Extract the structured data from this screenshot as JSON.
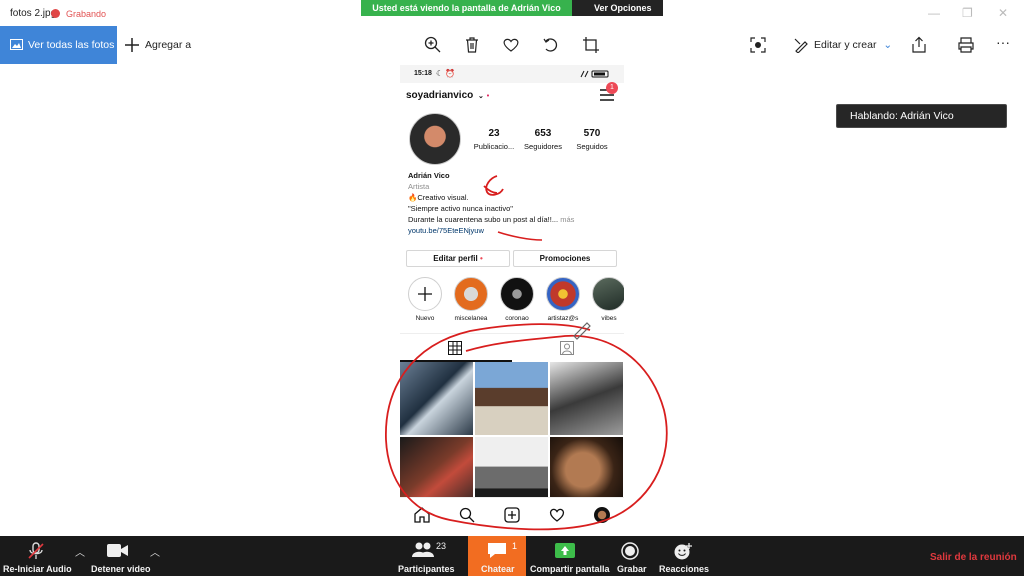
{
  "window": {
    "title": "fotos 2.jpg",
    "recording_label": "Grabando",
    "banner_text": "Usted está viendo la pantalla de Adrián Vico",
    "view_options": "Ver Opciones"
  },
  "toolbar": {
    "see_all": "Ver todas las fotos",
    "add_to": "Agregar a",
    "edit_create": "Editar y crear",
    "icons": [
      "zoom-in-icon",
      "delete-icon",
      "favorite-icon",
      "rotate-icon",
      "crop-icon",
      "enhance-icon",
      "share-icon",
      "print-icon",
      "more-icon"
    ]
  },
  "speaking_label": "Hablando: Adrián Vico",
  "phone": {
    "time": "15:18",
    "username": "soyadrianvico",
    "notification_count": "1",
    "stats": [
      {
        "value": "23",
        "label": "Publicacio..."
      },
      {
        "value": "653",
        "label": "Seguidores"
      },
      {
        "value": "570",
        "label": "Seguidos"
      }
    ],
    "bio": {
      "name": "Adrián Vico",
      "category": "Artista",
      "line1": "🔥Creativo visual.",
      "line2": "\"Siempre activo nunca inactivo\"",
      "line3": "Durante la cuarentena subo un post al día!!...",
      "more": "más",
      "link": "youtu.be/75EteENjyuw"
    },
    "buttons": {
      "edit_profile": "Editar perfil",
      "promotions": "Promociones"
    },
    "highlights": [
      {
        "label": "Nuevo"
      },
      {
        "label": "miscelanea"
      },
      {
        "label": "coronao"
      },
      {
        "label": "artistaz@s"
      },
      {
        "label": "vibes"
      }
    ]
  },
  "zoom_bar": {
    "mute": "Re-Iniciar Audio",
    "video": "Detener video",
    "participants": "Participantes",
    "participants_count": "23",
    "chat": "Chatear",
    "chat_count": "1",
    "share": "Compartir pantalla",
    "record": "Grabar",
    "reactions": "Reacciones",
    "leave": "Salir de la reunión"
  },
  "colors": {
    "banner_green": "#37b24d",
    "photos_blue": "#3f85d8",
    "chat_orange": "#f26d21",
    "leave_red": "#e0393e",
    "annotation_red": "#d81e1e"
  }
}
